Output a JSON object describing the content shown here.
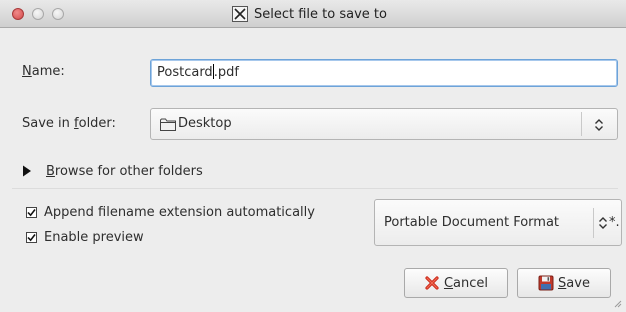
{
  "window": {
    "title": "Select file to save to"
  },
  "form": {
    "name_label_mnemonic": "N",
    "name_label_rest": "ame:",
    "name_value_before_cursor": "Postcard",
    "name_value_after_cursor": ".pdf",
    "folder_label_prefix": "Save in ",
    "folder_label_mnemonic": "f",
    "folder_label_rest": "older:",
    "folder_value": "Desktop",
    "browse_mnemonic": "B",
    "browse_rest": "rowse for other folders"
  },
  "options": {
    "append_extension_label": "Append filename extension automatically",
    "append_extension_checked": true,
    "enable_preview_label": "Enable preview",
    "enable_preview_checked": true,
    "file_format_value": "Portable Document Format",
    "file_format_suffix": "*."
  },
  "buttons": {
    "cancel_mnemonic": "C",
    "cancel_rest": "ancel",
    "save_mnemonic": "S",
    "save_rest": "ave"
  },
  "icons": {
    "close": "window-close-icon",
    "minimize": "window-minimize-icon",
    "maximize": "window-maximize-icon",
    "app": "x-window-icon",
    "folder": "folder-icon",
    "expander": "triangle-right-icon",
    "cancel": "cancel-x-icon",
    "save": "floppy-disk-icon"
  },
  "colors": {
    "close_button": "#d34a4a",
    "focus_border": "#6da3d8",
    "cancel_icon": "#cc2a1a",
    "save_icon": "#c0392b"
  }
}
